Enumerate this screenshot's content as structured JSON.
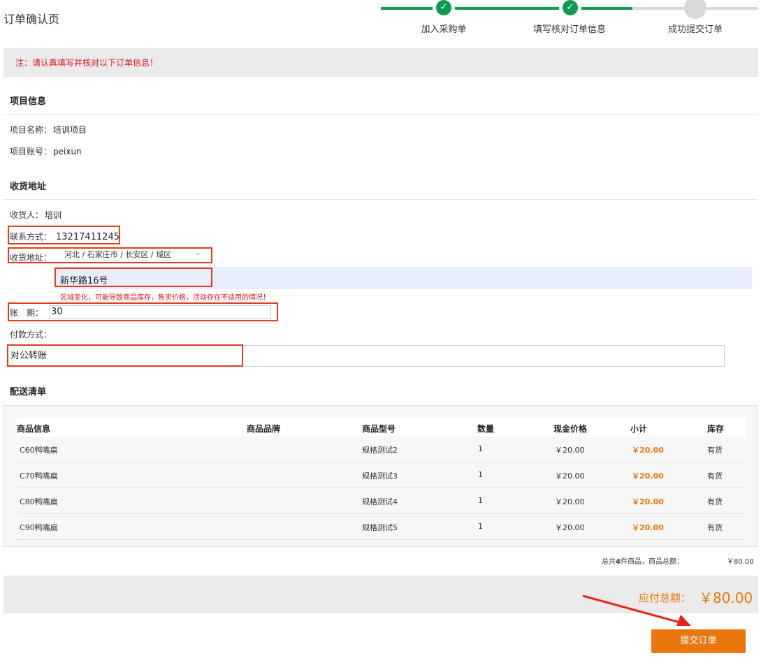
{
  "page": {
    "title": "订单确认页"
  },
  "stepper": {
    "steps": [
      {
        "label": "加入采购单",
        "status": "done"
      },
      {
        "label": "填写核对订单信息",
        "status": "done"
      },
      {
        "label": "成功提交订单",
        "status": "pending"
      }
    ],
    "check_glyph": "✓",
    "active_color": "#0e9a4f"
  },
  "notice": {
    "text": "注：请认真填写并核对以下订单信息！"
  },
  "project": {
    "title": "项目信息",
    "name_label": "项目名称：",
    "name_value": "培训项目",
    "account_label": "项目账号：",
    "account_value": "peixun"
  },
  "address": {
    "title": "收货地址",
    "receiver_label": "收货人：",
    "receiver_value": "培训",
    "contact_label": "联系方式：",
    "contact_value": "13217411245",
    "region_label": "收货地址：",
    "region_value": "河北 / 石家庄市 / 长安区 / 城区",
    "street_value": "新华路16号",
    "warning": "区域变化，可能导致商品库存，售卖价格，活动存在不适用的情况！",
    "period_label": "账　期：",
    "period_value": "30",
    "payment_label": "付款方式：",
    "payment_value": "对公转账"
  },
  "delivery": {
    "title": "配送清单",
    "columns": [
      "商品信息",
      "商品品牌",
      "商品型号",
      "数量",
      "现金价格",
      "小计",
      "库存"
    ],
    "rows": [
      {
        "name": "C60鸭嘴扁",
        "brand": "",
        "model": "规格测试2",
        "qty": "1",
        "price": "￥20.00",
        "subtotal": "￥20.00",
        "stock": "有货"
      },
      {
        "name": "C70鸭嘴扁",
        "brand": "",
        "model": "规格测试3",
        "qty": "1",
        "price": "￥20.00",
        "subtotal": "￥20.00",
        "stock": "有货"
      },
      {
        "name": "C80鸭嘴扁",
        "brand": "",
        "model": "规格测试4",
        "qty": "1",
        "price": "￥20.00",
        "subtotal": "￥20.00",
        "stock": "有货"
      },
      {
        "name": "C90鸭嘴扁",
        "brand": "",
        "model": "规格测试5",
        "qty": "1",
        "price": "￥20.00",
        "subtotal": "￥20.00",
        "stock": "有货"
      }
    ]
  },
  "summary": {
    "prefix": "总共",
    "count": "4",
    "suffix": "件商品，商品总额：",
    "amount": "￥80.00"
  },
  "total": {
    "label": "应付总额：",
    "value": "￥80.00",
    "accent_color": "#e9770e"
  },
  "submit": {
    "label": "提交订单"
  }
}
